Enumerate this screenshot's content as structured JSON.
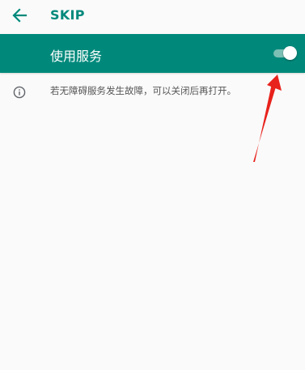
{
  "colors": {
    "primary": "#00897b",
    "background": "#fafafa",
    "annotation": "#e8221c"
  },
  "app_bar": {
    "back_icon": "arrow-left-icon",
    "title": "SKIP"
  },
  "service_switch": {
    "label": "使用服务",
    "checked": true
  },
  "info": {
    "icon": "info-circle-icon",
    "text": "若无障碍服务发生故障，可以关闭后再打开。"
  }
}
